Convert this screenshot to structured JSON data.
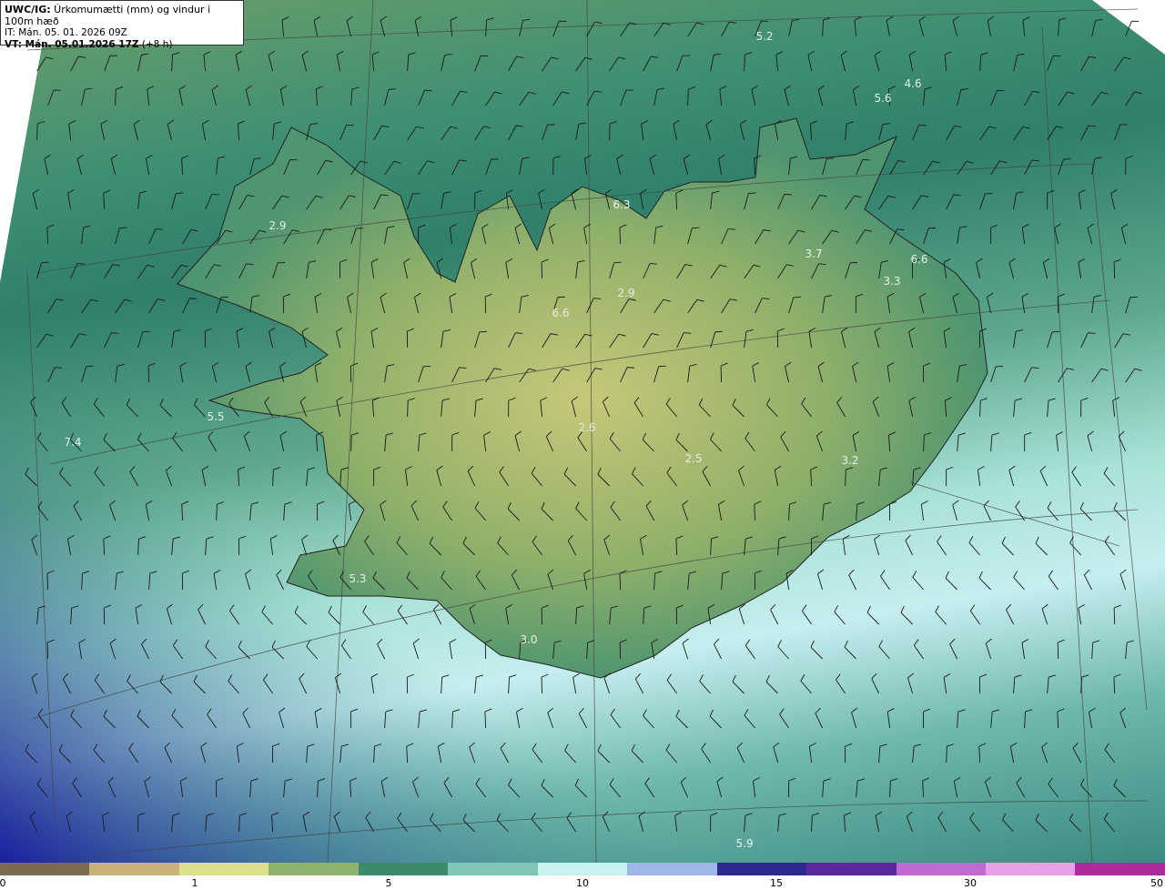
{
  "header": {
    "line1_bold": "UWC/IG:",
    "line1_rest": " Úrkomumætti (mm) og vindur i 100m hæð",
    "line2": "IT: Mán. 05. 01. 2026 09Z",
    "line3_bold": "VT: Mán. 05.01.2026 17Z",
    "line3_rest": " (+8 h)"
  },
  "value_labels": [
    {
      "text": "5.2"
    },
    {
      "text": "4.6"
    },
    {
      "text": "5.6"
    },
    {
      "text": "6.3"
    },
    {
      "text": "2.9"
    },
    {
      "text": "3.7"
    },
    {
      "text": "6.6"
    },
    {
      "text": "3.3"
    },
    {
      "text": "2.9"
    },
    {
      "text": "6.6"
    },
    {
      "text": "5.5"
    },
    {
      "text": "7.4"
    },
    {
      "text": "2.6"
    },
    {
      "text": "2.5"
    },
    {
      "text": "3.2"
    },
    {
      "text": "5.3"
    },
    {
      "text": "3.0"
    },
    {
      "text": "5.9"
    }
  ],
  "colorbar": {
    "ticks": [
      "0",
      "1",
      "5",
      "10",
      "15",
      "30",
      "50"
    ],
    "colors": [
      "#7a6a4e",
      "#c9b27a",
      "#dde08a",
      "#8fb36f",
      "#3c8a6c",
      "#7fc6b6",
      "#c8f2f2",
      "#9fb7e6",
      "#2c2a8a",
      "#5a2a9a",
      "#c06ad0",
      "#e8a0e6",
      "#b02a9a"
    ]
  }
}
